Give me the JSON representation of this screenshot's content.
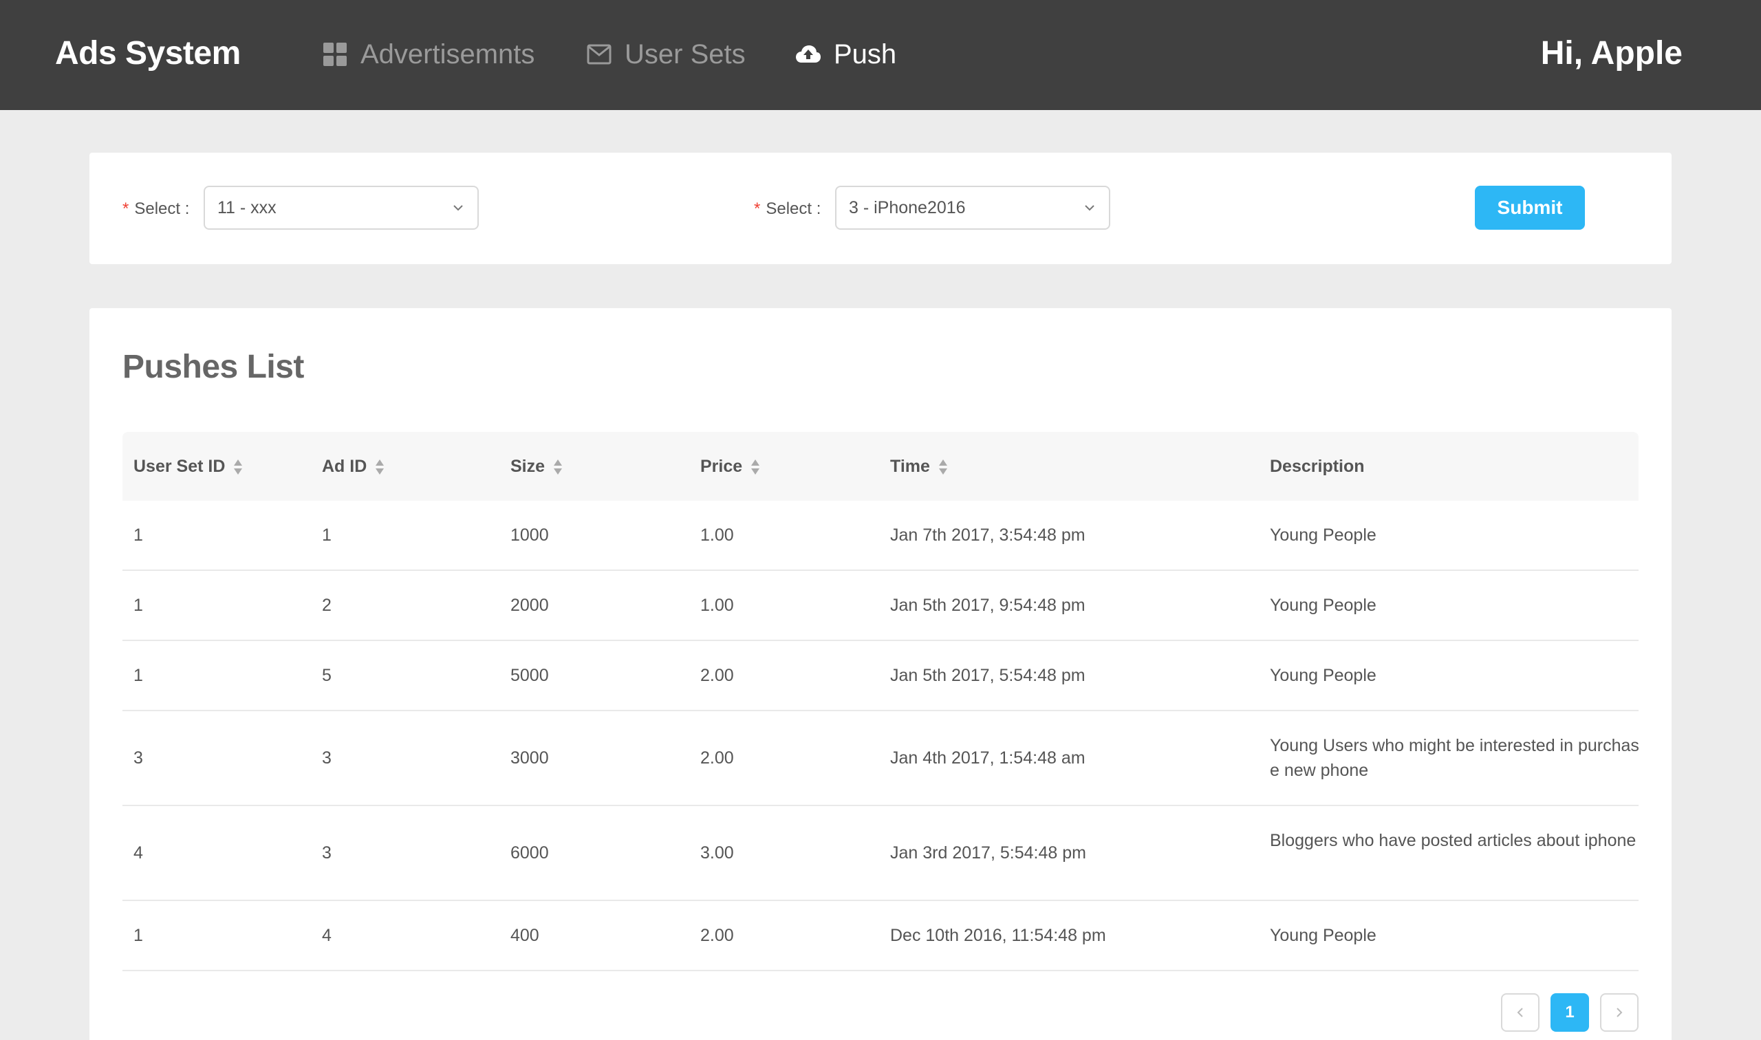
{
  "header": {
    "brand": "Ads System",
    "nav": [
      {
        "label": "Advertisemnts",
        "icon": "grid-icon",
        "active": false
      },
      {
        "label": "User Sets",
        "icon": "mail-icon",
        "active": false
      },
      {
        "label": "Push",
        "icon": "cloud-upload-icon",
        "active": true
      }
    ],
    "greeting": "Hi, Apple"
  },
  "filter": {
    "field1": {
      "label": "Select :",
      "value": "11 - xxx"
    },
    "field2": {
      "label": "Select :",
      "value": "3 - iPhone2016"
    },
    "submit_label": "Submit",
    "required_mark": "*"
  },
  "list": {
    "title": "Pushes List",
    "columns": [
      "User Set ID",
      "Ad ID",
      "Size",
      "Price",
      "Time",
      "Description"
    ],
    "rows": [
      {
        "user_set_id": "1",
        "ad_id": "1",
        "size": "1000",
        "price": "1.00",
        "time": "Jan 7th 2017, 3:54:48 pm",
        "description": "Young People"
      },
      {
        "user_set_id": "1",
        "ad_id": "2",
        "size": "2000",
        "price": "1.00",
        "time": "Jan 5th 2017, 9:54:48 pm",
        "description": "Young People"
      },
      {
        "user_set_id": "1",
        "ad_id": "5",
        "size": "5000",
        "price": "2.00",
        "time": "Jan 5th 2017, 5:54:48 pm",
        "description": "Young People"
      },
      {
        "user_set_id": "3",
        "ad_id": "3",
        "size": "3000",
        "price": "2.00",
        "time": "Jan 4th 2017, 1:54:48 am",
        "description": "Young Users who might be interested in purchase new phone"
      },
      {
        "user_set_id": "4",
        "ad_id": "3",
        "size": "6000",
        "price": "3.00",
        "time": "Jan 3rd 2017, 5:54:48 pm",
        "description": "Bloggers who have posted articles about iphone"
      },
      {
        "user_set_id": "1",
        "ad_id": "4",
        "size": "400",
        "price": "2.00",
        "time": "Dec 10th 2016, 11:54:48 pm",
        "description": "Young People"
      }
    ]
  },
  "pagination": {
    "current_page": "1",
    "prev": "‹",
    "next": "›"
  },
  "colors": {
    "header_bg": "#404040",
    "accent": "#2db7f5",
    "page_bg": "#ececec"
  }
}
